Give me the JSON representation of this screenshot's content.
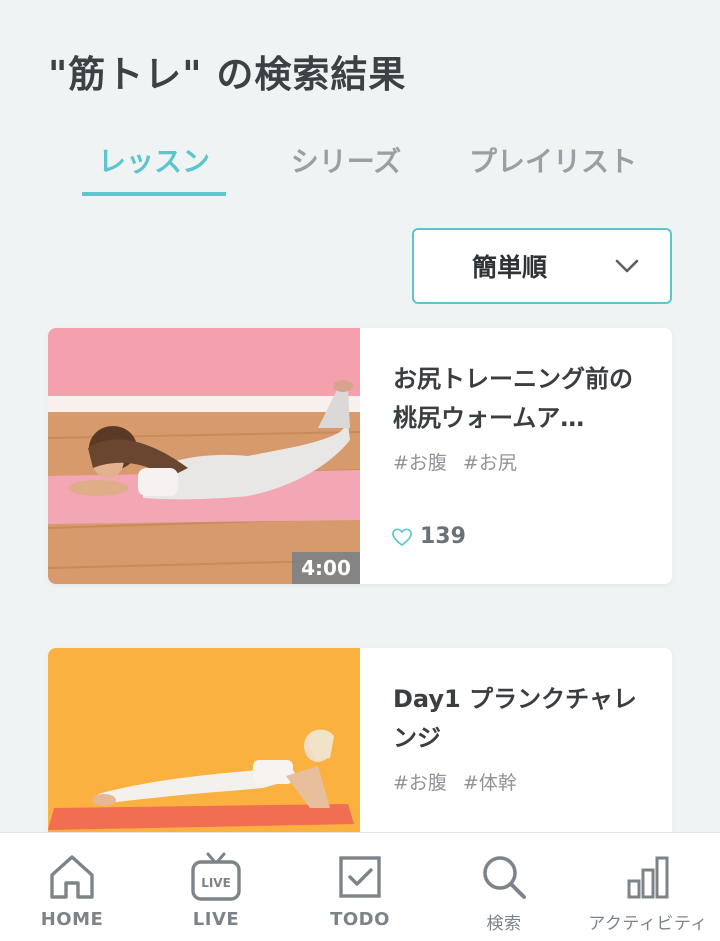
{
  "header": {
    "title": "\"筋トレ\" の検索結果"
  },
  "tabs": [
    {
      "label": "レッスン",
      "active": true
    },
    {
      "label": "シリーズ",
      "active": false
    },
    {
      "label": "プレイリスト",
      "active": false
    }
  ],
  "sort": {
    "selected": "簡単順"
  },
  "lessons": [
    {
      "title": "お尻トレーニング前の桃尻ウォームア…",
      "tags": [
        "#お腹",
        "#お尻"
      ],
      "likes": "139",
      "duration": "4:00"
    },
    {
      "title": "Day1 プランクチャレンジ",
      "tags": [
        "#お腹",
        "#体幹"
      ]
    }
  ],
  "nav": {
    "items": [
      {
        "label": "HOME",
        "icon": "home-icon"
      },
      {
        "label": "LIVE",
        "icon": "live-tv-icon",
        "badge": "LIVE"
      },
      {
        "label": "TODO",
        "icon": "todo-checkbox-icon"
      },
      {
        "label": "検索",
        "icon": "search-icon"
      },
      {
        "label": "アクティビティ",
        "icon": "activity-bar-chart-icon"
      }
    ]
  },
  "colors": {
    "accent": "#5cc6cc",
    "background": "#eff3f4",
    "text": "#3d4144",
    "muted": "#9a9fa3"
  }
}
